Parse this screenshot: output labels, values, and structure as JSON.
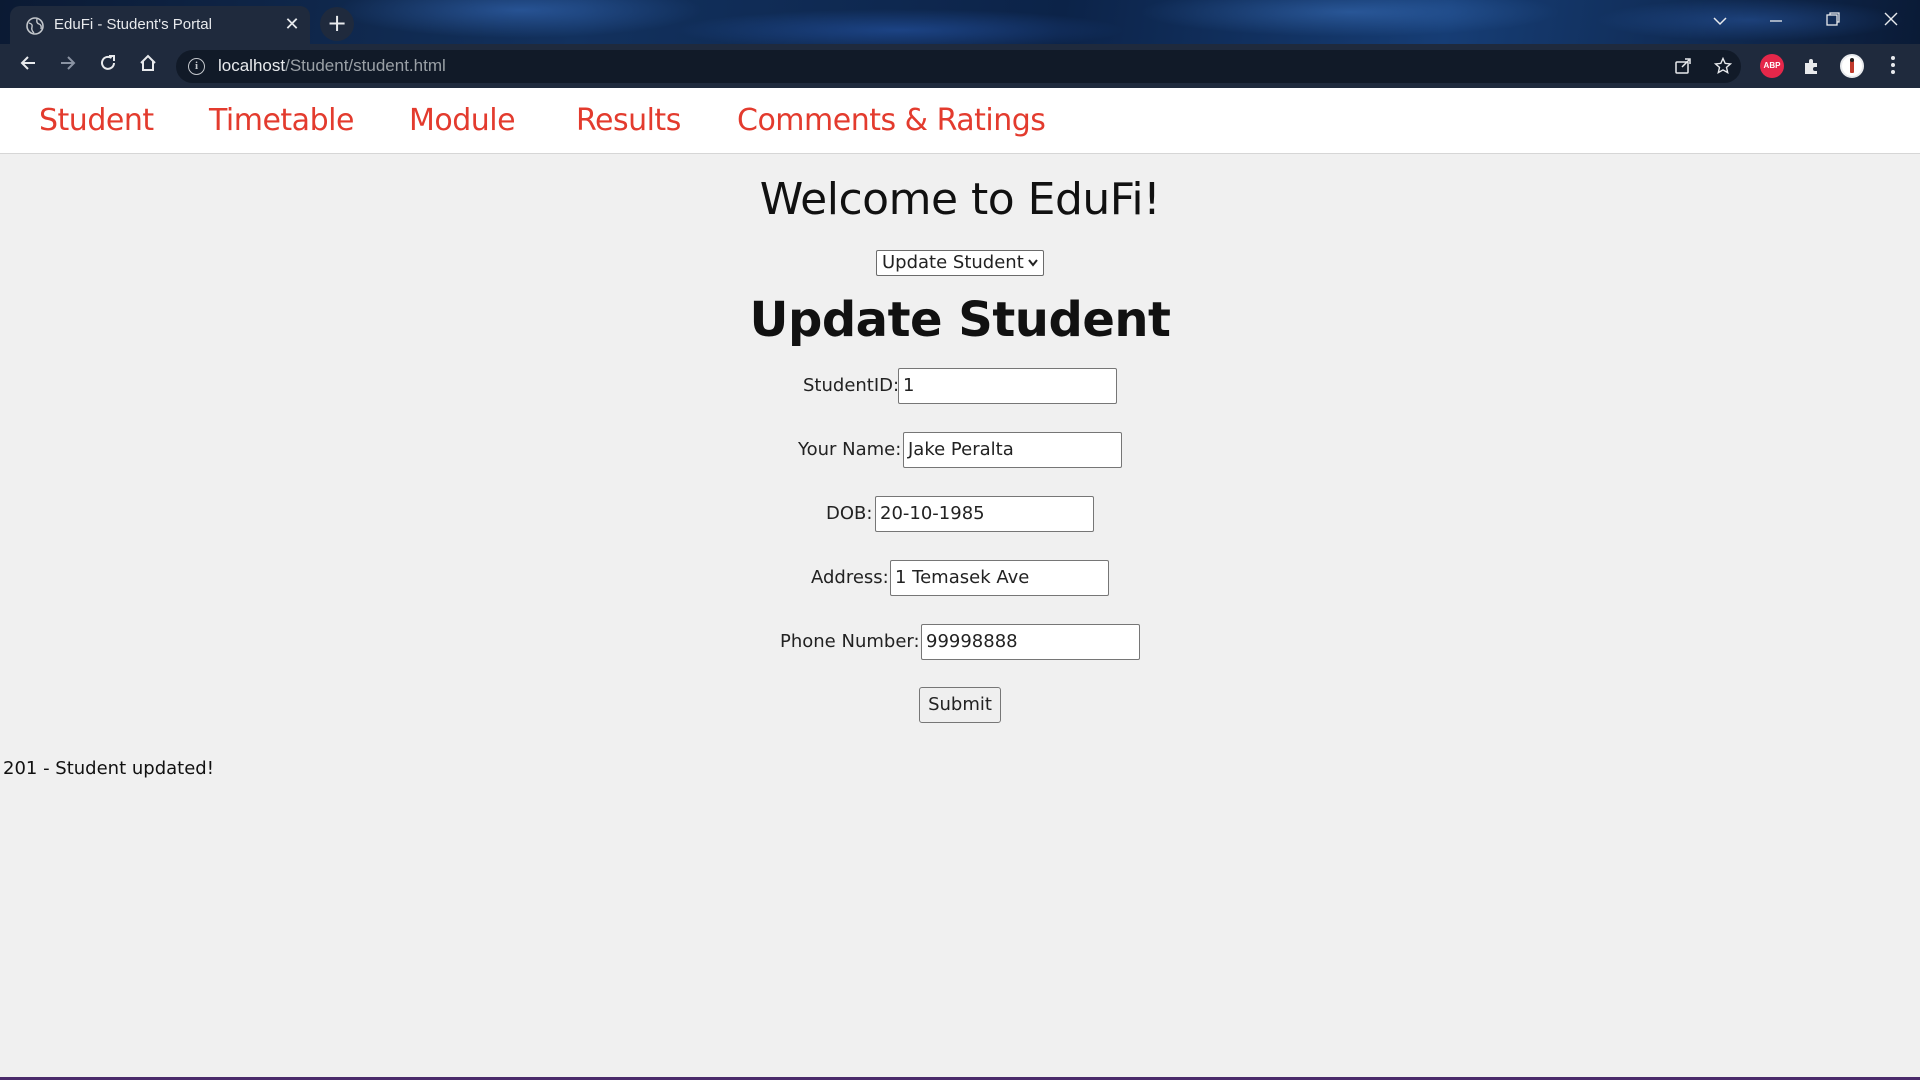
{
  "browser": {
    "tab_title": "EduFi - Student's Portal",
    "tab_close": "✕",
    "new_tab": "+",
    "url_host": "localhost",
    "url_path": "/Student/student.html",
    "ext_abp": "ABP"
  },
  "nav": {
    "items": [
      "Student",
      "Timetable",
      "Module",
      "Results",
      "Comments & Ratings"
    ]
  },
  "main": {
    "welcome": "Welcome to EduFi!",
    "action_select": "Update Student",
    "form_title": "Update Student",
    "fields": [
      {
        "label": "StudentID:",
        "value": "1"
      },
      {
        "label": "Your Name:",
        "value": "Jake Peralta"
      },
      {
        "label": "DOB:",
        "value": "20-10-1985"
      },
      {
        "label": "Address:",
        "value": "1 Temasek Ave"
      },
      {
        "label": "Phone Number:",
        "value": "99998888"
      }
    ],
    "submit_label": "Submit",
    "status_message": "201 - Student updated!"
  },
  "colors": {
    "nav_link": "#e33b2e",
    "chrome_bg": "#1f2a3d",
    "page_bg": "#f0f0f0"
  },
  "icons": [
    "globe-icon",
    "close-icon",
    "plus-icon",
    "back-icon",
    "forward-icon",
    "reload-icon",
    "home-icon",
    "info-icon",
    "share-icon",
    "star-icon",
    "adblock-icon",
    "puzzle-icon",
    "profile-icon",
    "menu-icon",
    "minimize-icon",
    "restore-icon",
    "window-close-icon",
    "tab-search-icon"
  ]
}
